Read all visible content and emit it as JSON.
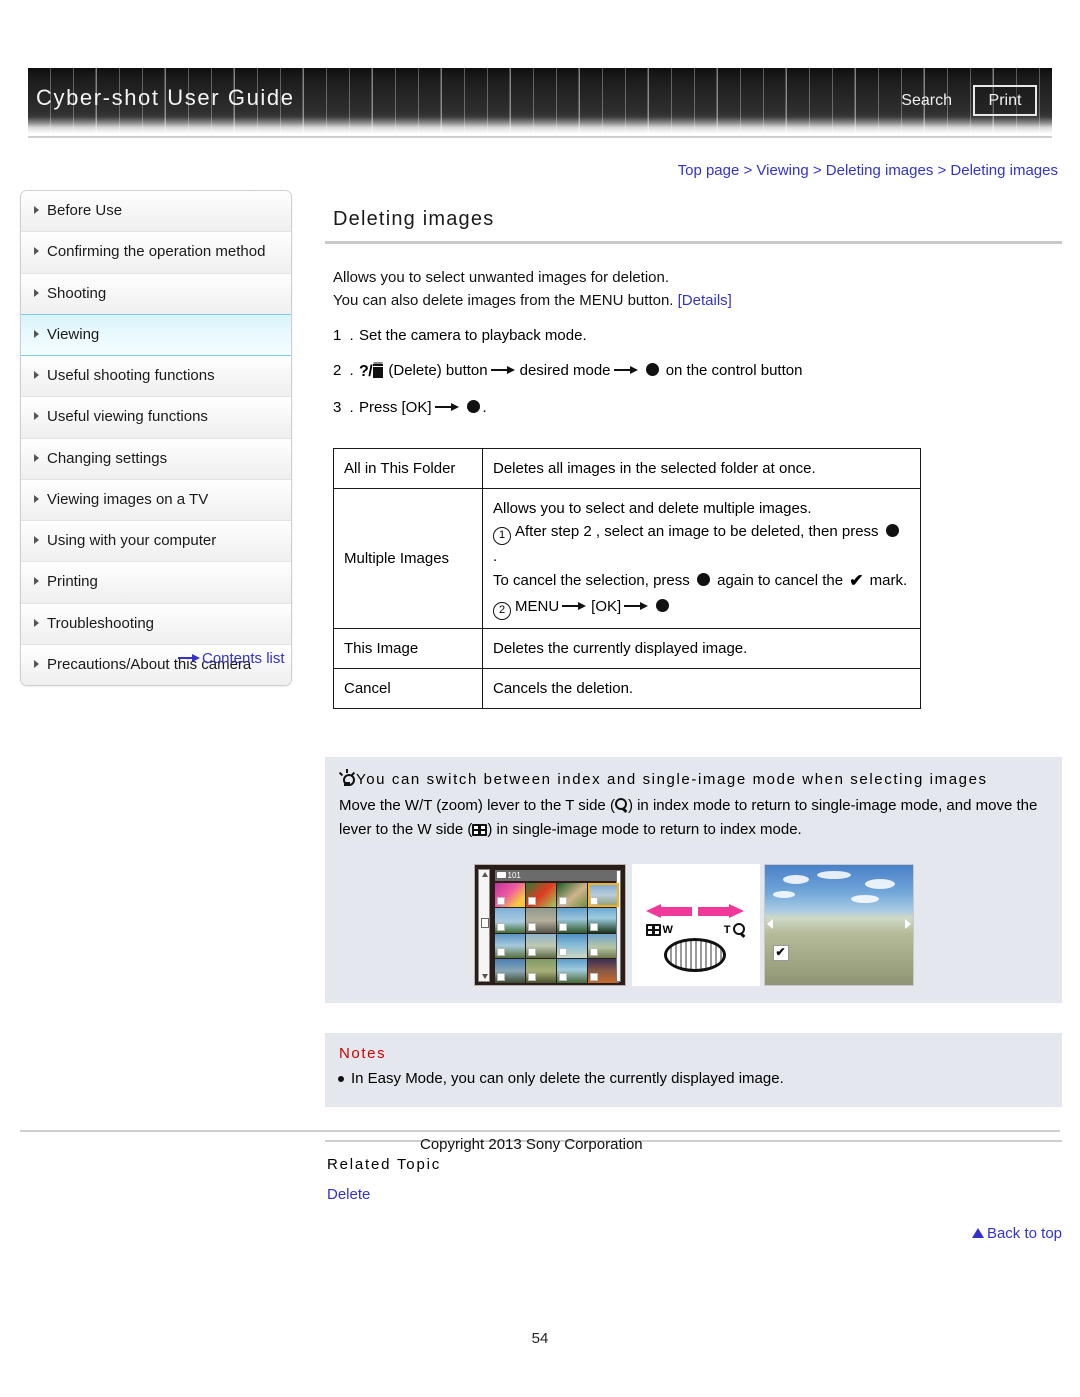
{
  "header": {
    "title": "Cyber-shot User Guide",
    "search_label": "Search",
    "print_label": "Print"
  },
  "breadcrumb": {
    "items": [
      "Top page",
      "Viewing",
      "Deleting images",
      "Deleting images"
    ],
    "separator": ">",
    "text": "Top page > Viewing > Deleting images > Deleting images",
    "color": "#3333cc"
  },
  "sidebar": {
    "items": [
      {
        "label": "Before Use",
        "active": false
      },
      {
        "label": "Confirming the operation method",
        "active": false
      },
      {
        "label": "Shooting",
        "active": false
      },
      {
        "label": "Viewing",
        "active": true
      },
      {
        "label": "Useful shooting functions",
        "active": false
      },
      {
        "label": "Useful viewing functions",
        "active": false
      },
      {
        "label": "Changing settings",
        "active": false
      },
      {
        "label": "Viewing images on a TV",
        "active": false
      },
      {
        "label": "Using with your computer",
        "active": false
      },
      {
        "label": "Printing",
        "active": false
      },
      {
        "label": "Troubleshooting",
        "active": false
      },
      {
        "label": "Precautions/About this camera",
        "active": false
      }
    ],
    "contents_list_label": "Contents list",
    "active_color": "#d9f3fb"
  },
  "main": {
    "page_title": "Deleting images",
    "intro_line1": "Allows you to select unwanted images for deletion.",
    "intro_line2_prefix": "You can also delete images from the MENU button.",
    "intro_line2_link": "[Details]",
    "steps": [
      {
        "number": "1 .",
        "text": "Set the camera to playback mode."
      },
      {
        "number": "2 .",
        "pre_icon": "delete-button-icon",
        "text_a": "(Delete) button",
        "text_b": "desired mode",
        "text_c": "on the control button"
      },
      {
        "number": "3 .",
        "text_a": "Press [OK]",
        "text_b": "."
      }
    ],
    "table": {
      "rows": [
        {
          "key": "All in This Folder",
          "value": "Deletes all images in the selected folder at once."
        },
        {
          "key": "Multiple Images",
          "line1": "Allows you to select and delete multiple images.",
          "circle1": "1",
          "line2": "After step 2 , select an image to be deleted, then press",
          "line2_suffix": ".",
          "line3_a": "To cancel the selection, press",
          "line3_b": "again to cancel the",
          "line3_c": "mark.",
          "circle2": "2",
          "line4_a": "MENU",
          "line4_b": "[OK]"
        },
        {
          "key": "This Image",
          "value": "Deletes the currently displayed image."
        },
        {
          "key": "Cancel",
          "value": "Cancels the deletion."
        }
      ]
    },
    "tip": {
      "heading": "You can switch between index and single-image mode when selecting images",
      "body_a": "Move the W/T (zoom) lever to the T side (",
      "body_b": ") in index mode to return to single-image mode, and move the lever to the W side (",
      "body_c": ") in single-image mode to return to index mode.",
      "illustration": {
        "index_screen_folder": "101",
        "lever_label_w": "W",
        "lever_label_t": "T",
        "check_glyph": "✔"
      },
      "background": "#e4e8ee"
    },
    "notes": {
      "title": "Notes",
      "title_color": "#cc0000",
      "items": [
        "In Easy Mode, you can only delete the currently displayed image."
      ],
      "background": "#e4e8ee"
    },
    "related": {
      "title": "Related Topic",
      "links": [
        "Delete"
      ]
    },
    "back_to_top": "Back to top"
  },
  "footer": {
    "copyright": "Copyright 2013 Sony Corporation",
    "page_number": "54"
  }
}
